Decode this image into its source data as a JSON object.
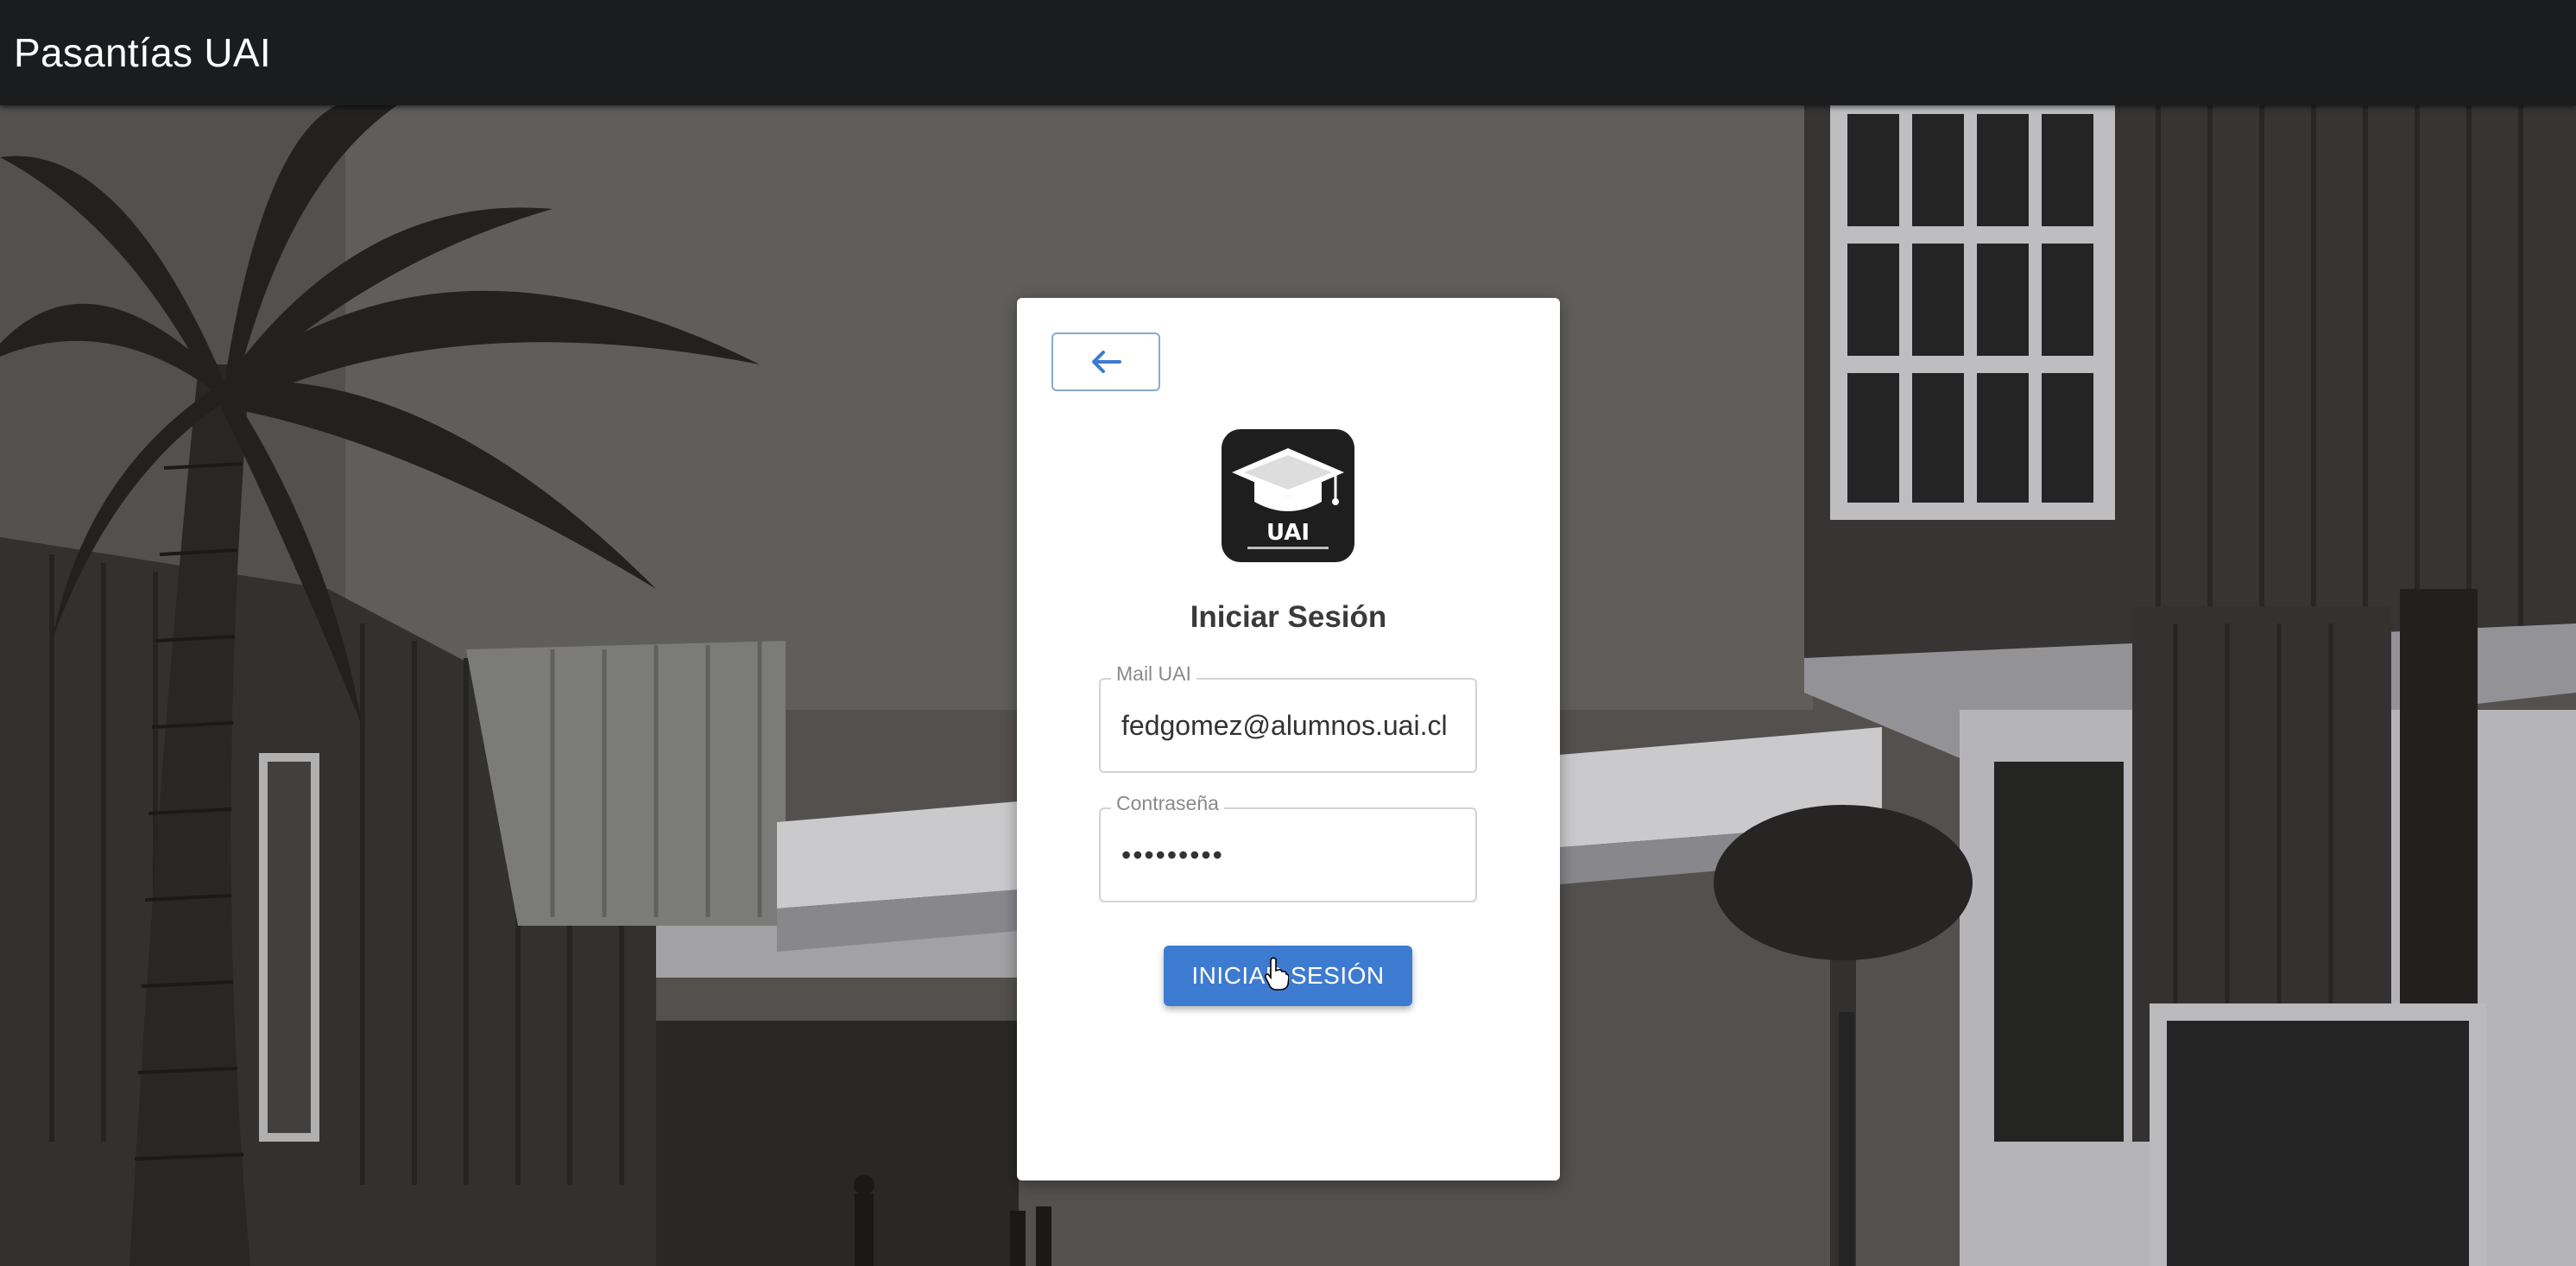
{
  "app": {
    "title": "Pasantías UAI"
  },
  "login": {
    "title": "Iniciar Sesión",
    "email": {
      "label": "Mail UAI",
      "value": "fedgomez@alumnos.uai.cl"
    },
    "password": {
      "label": "Contraseña",
      "value": "•••••••••"
    },
    "submit_label": "INICIAR SESIÓN",
    "back_icon": "arrow-left-icon",
    "logo_icon": "graduation-cap-icon",
    "logo_text": "UAI"
  },
  "colors": {
    "appbar": "#1b1c1e",
    "primary": "#3d7bd0",
    "card": "#ffffff",
    "back_border": "#8aaad0"
  }
}
